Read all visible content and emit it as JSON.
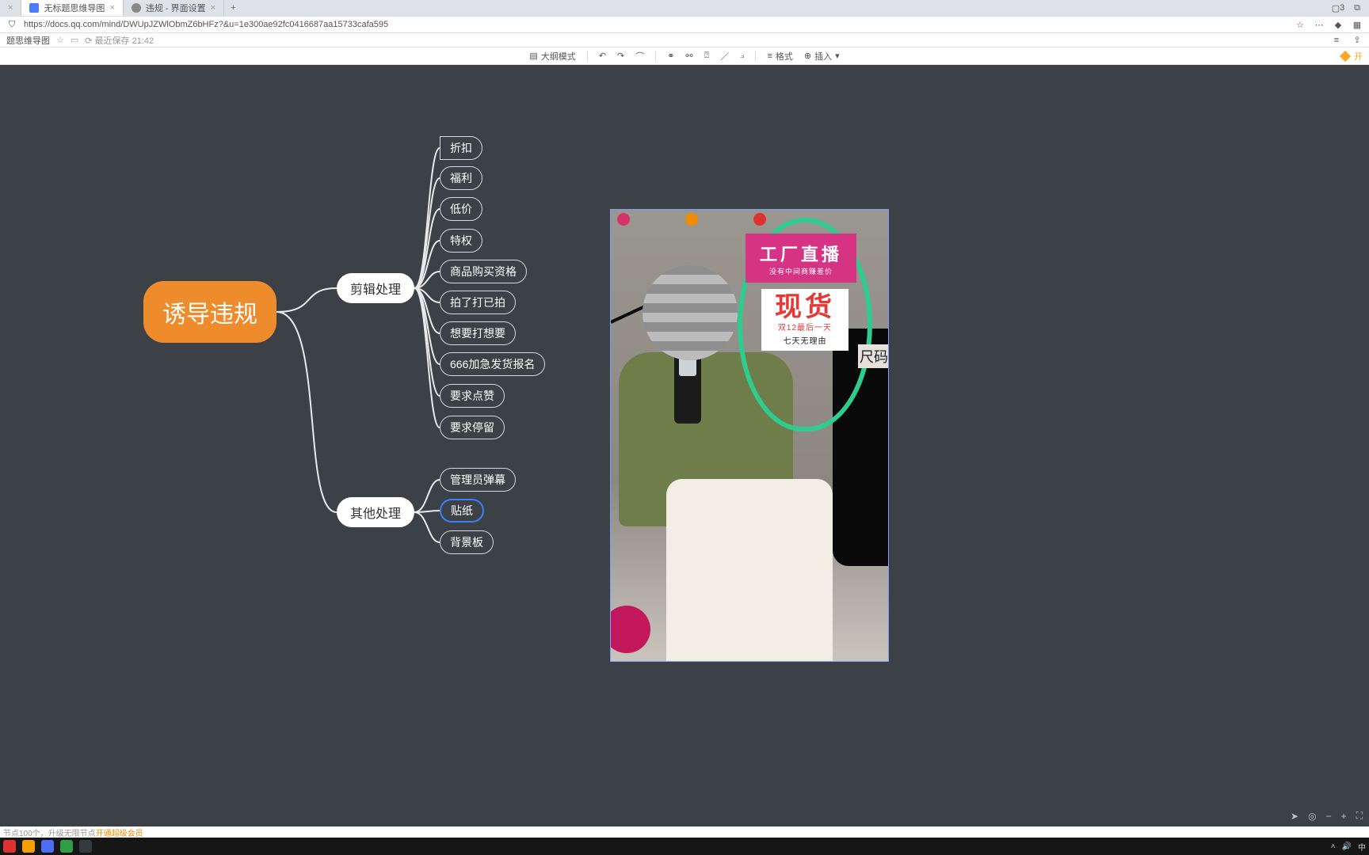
{
  "browser": {
    "tabs": [
      {
        "title": "",
        "active": false
      },
      {
        "title": "无标题思维导图",
        "active": true
      },
      {
        "title": "违规 - 界面设置",
        "active": false
      }
    ],
    "url": "https://docs.qq.com/mind/DWUpJZWlObmZ6bHFz?&u=1e300ae92fc0416687aa15733cafa595",
    "win_controls": {
      "tabcount": "3"
    }
  },
  "doc_header": {
    "title": "题思维导图",
    "autosave_label": "最近保存 21:42"
  },
  "toolbar": {
    "outline": "大纲模式",
    "format": "格式",
    "insert": "插入",
    "right_label": "开"
  },
  "mindmap": {
    "root": "诱导违规",
    "branches": [
      {
        "label": "剪辑处理",
        "leaves": [
          "折扣",
          "福利",
          "低价",
          "特权",
          "商品购买资格",
          "拍了打已拍",
          "想要打想要",
          "666加急发货报名",
          "要求点赞",
          "要求停留"
        ]
      },
      {
        "label": "其他处理",
        "leaves": [
          "管理员弹幕",
          "贴纸",
          "背景板"
        ],
        "selected_index": 1
      }
    ]
  },
  "image_panel": {
    "sign_pink_main": "工厂直播",
    "sign_pink_sub": "没有中间商赚差价",
    "sign_white_big": "现货",
    "sign_white_mid": "双12最后一天",
    "sign_white_small": "七天无理由",
    "side_label": "尺码"
  },
  "footer": {
    "hint_prefix": "节点100个，升级无限节点",
    "hint_link": "开通超级会员"
  },
  "taskbar": {
    "right_text": "中"
  }
}
